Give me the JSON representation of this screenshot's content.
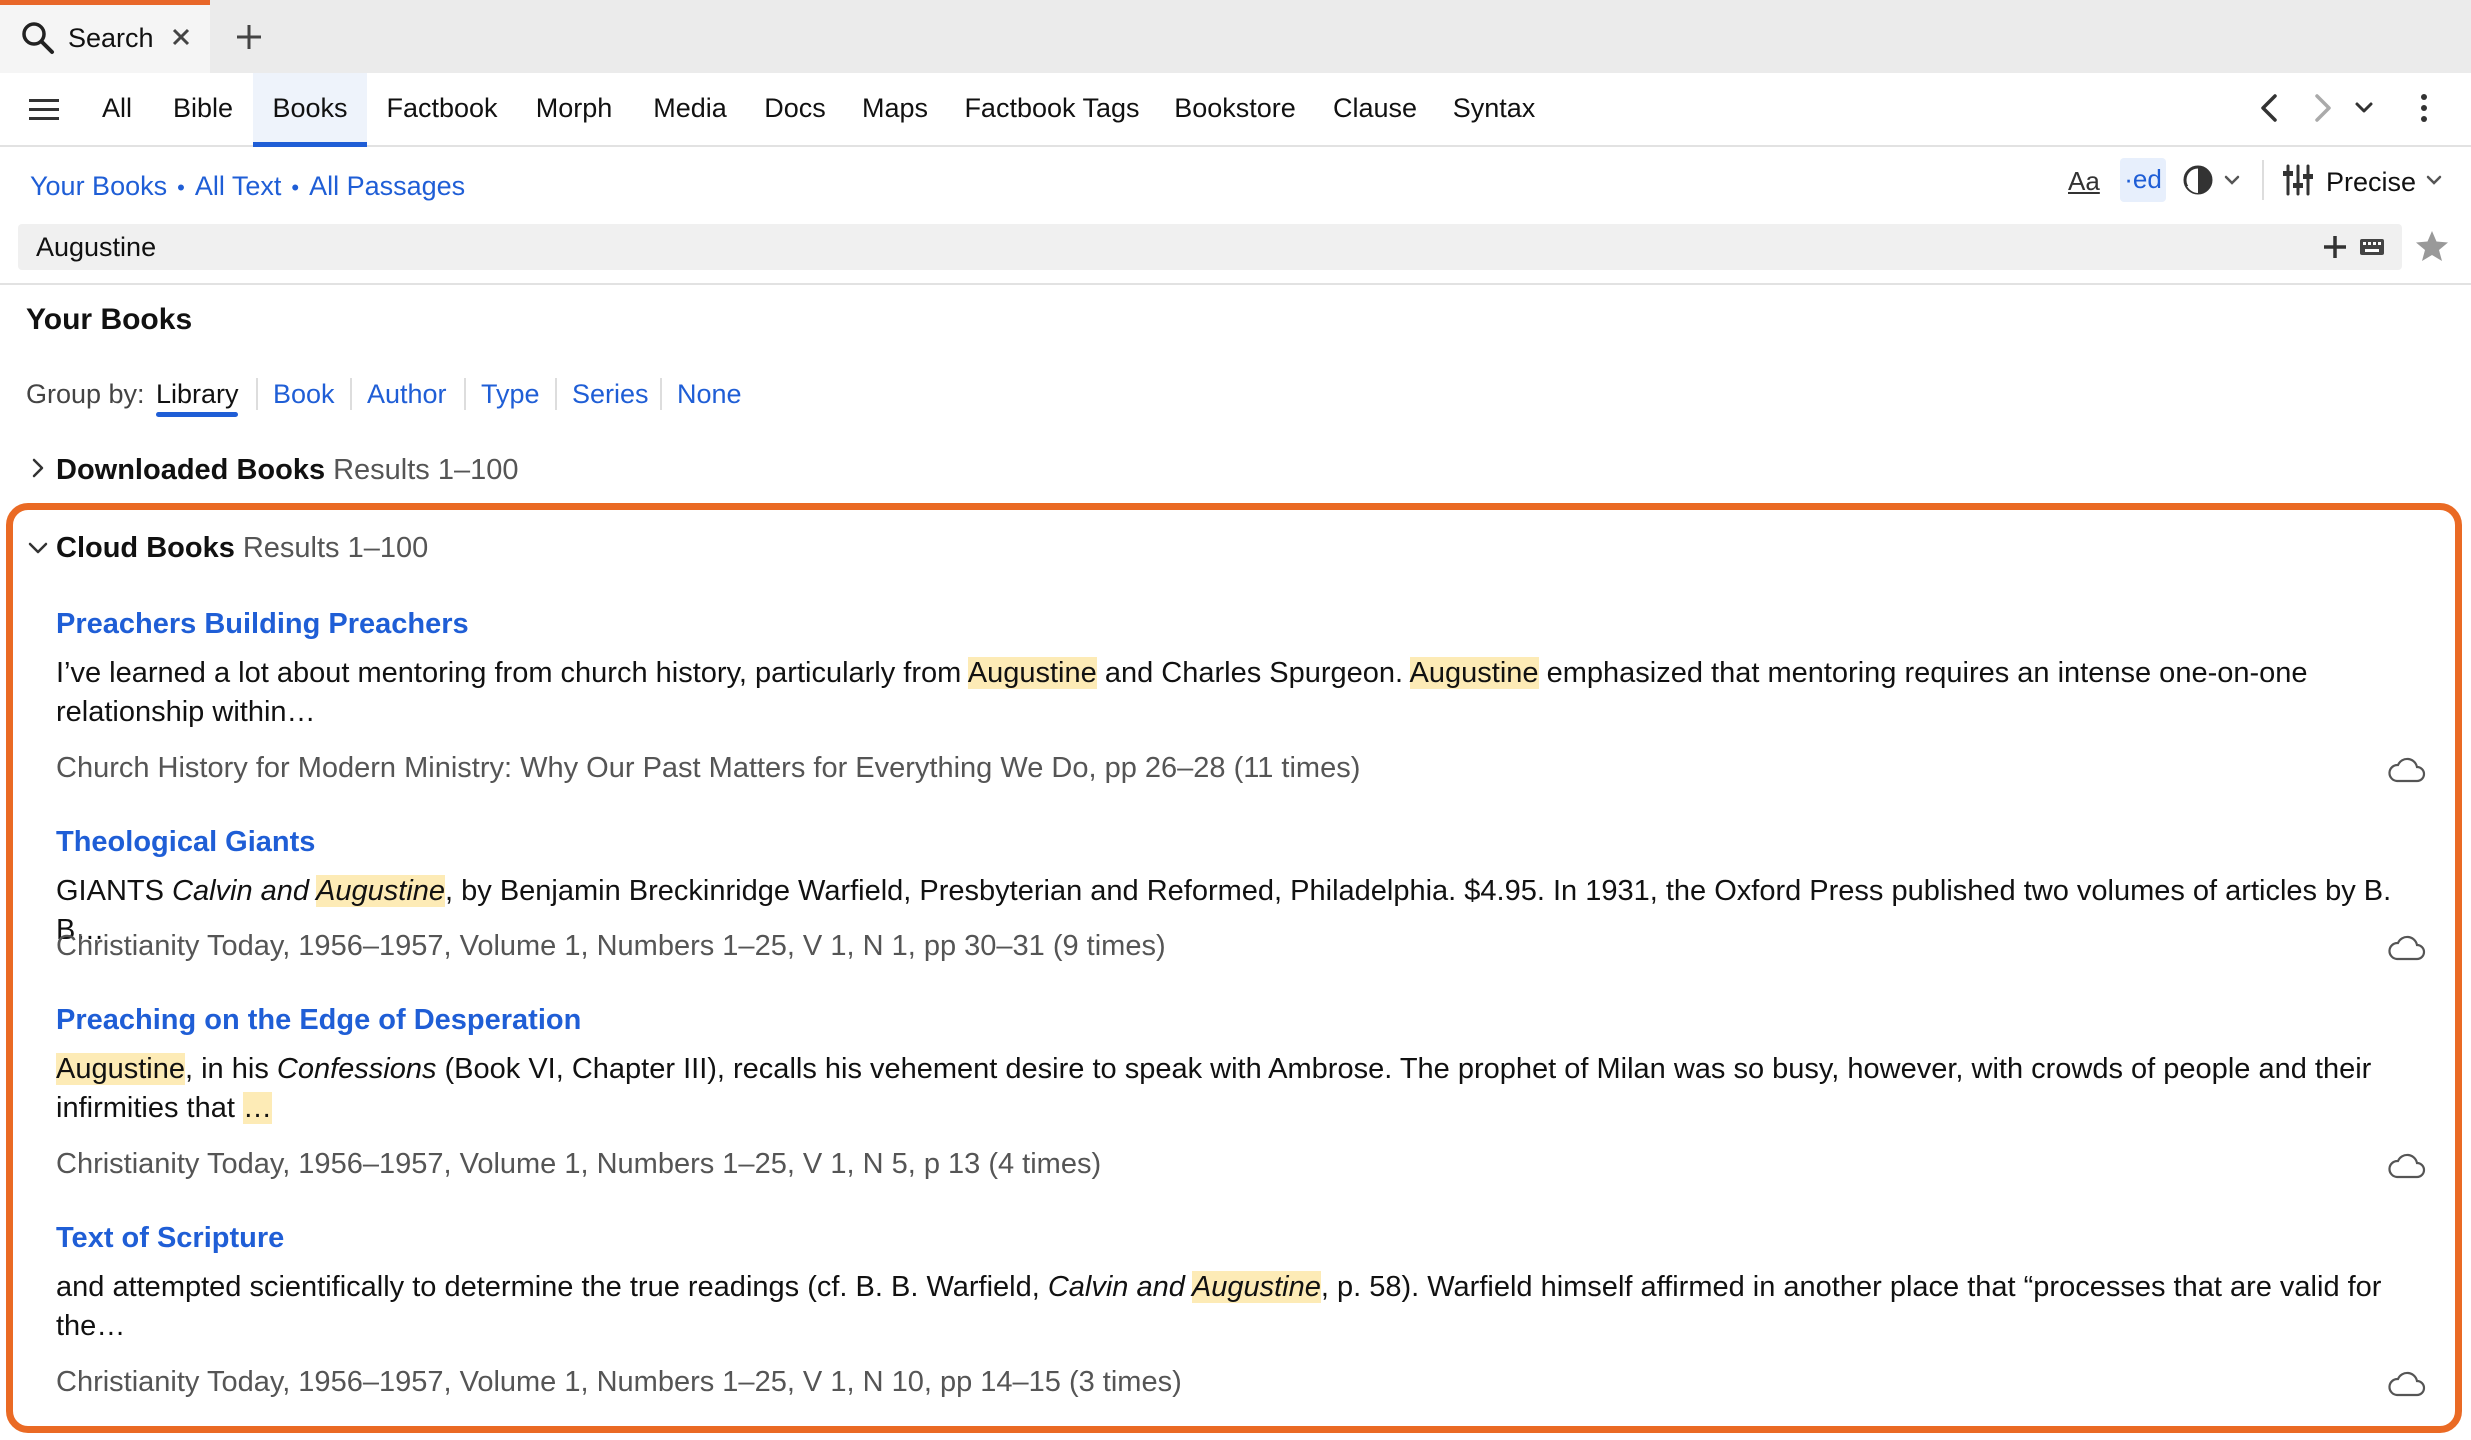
{
  "tab": {
    "title": "Search"
  },
  "nav": {
    "tabs": [
      {
        "label": "All"
      },
      {
        "label": "Bible"
      },
      {
        "label": "Books"
      },
      {
        "label": "Factbook"
      },
      {
        "label": "Morph"
      },
      {
        "label": "Media"
      },
      {
        "label": "Docs"
      },
      {
        "label": "Maps"
      },
      {
        "label": "Factbook Tags"
      },
      {
        "label": "Bookstore"
      },
      {
        "label": "Clause"
      },
      {
        "label": "Syntax"
      }
    ],
    "active": "Books"
  },
  "scope": {
    "books": "Your Books",
    "text": "All Text",
    "passages": "All Passages",
    "separator": "•"
  },
  "options": {
    "case_label": "Aa",
    "match_label": "·ed",
    "mode": "Precise"
  },
  "search": {
    "query": "Augustine"
  },
  "section": {
    "title": "Your Books"
  },
  "group_by": {
    "label": "Group by:",
    "options": [
      "Library",
      "Book",
      "Author",
      "Type",
      "Series",
      "None"
    ],
    "active": "Library"
  },
  "groups": {
    "downloaded": {
      "title": "Downloaded Books",
      "count": "Results 1–100"
    },
    "cloud": {
      "title": "Cloud Books",
      "count": "Results 1–100"
    }
  },
  "results": [
    {
      "title": "Preachers Building Preachers",
      "snippet": [
        {
          "t": "I’ve learned a lot about mentoring from church history, particularly from "
        },
        {
          "t": "Augustine",
          "hl": true
        },
        {
          "t": " and Charles Spurgeon. "
        },
        {
          "t": "Augustine",
          "hl": true
        },
        {
          "t": " emphasized that mentoring requires an intense one-on-one relationship within…"
        }
      ],
      "reference": "Church History for Modern Ministry: Why Our Past Matters for Everything We Do, pp 26–28 (11 times)"
    },
    {
      "title": "Theological Giants",
      "snippet": [
        {
          "t": "GIANTS "
        },
        {
          "t": "Calvin and ",
          "i": true
        },
        {
          "t": "Augustine",
          "hl": true,
          "i": true
        },
        {
          "t": ", by Benjamin Breckinridge Warfield, Presbyterian and Reformed, Philadelphia. $4.95. In 1931, the Oxford Press published two volumes of articles by B. B…"
        }
      ],
      "reference": "Christianity Today, 1956–1957, Volume 1, Numbers 1–25, V 1, N 1, pp 30–31 (9 times)"
    },
    {
      "title": "Preaching on the Edge of Desperation",
      "snippet": [
        {
          "t": "Augustine",
          "hl": true
        },
        {
          "t": ", in his "
        },
        {
          "t": "Confessions",
          "i": true
        },
        {
          "t": " (Book VI, Chapter III), recalls his vehement desire to speak with Ambrose. The prophet of Milan was so busy, however, with crowds of people and their infirmities that "
        },
        {
          "t": "…",
          "hl": true
        }
      ],
      "reference": "Christianity Today, 1956–1957, Volume 1, Numbers 1–25, V 1, N 5, p 13 (4 times)"
    },
    {
      "title": "Text of Scripture",
      "snippet": [
        {
          "t": "and attempted scientifically to determine the true readings (cf. B. B. Warfield, "
        },
        {
          "t": "Calvin and ",
          "i": true
        },
        {
          "t": "Augustine",
          "hl": true,
          "i": true
        },
        {
          "t": ", p. 58). Warfield himself affirmed in another place that “processes that are valid for the…"
        }
      ],
      "reference": "Christianity Today, 1956–1957, Volume 1, Numbers 1–25, V 1, N 10, pp 14–15 (3 times)"
    }
  ],
  "colors": {
    "accent": "#1f5ed6",
    "frame": "#ea6a24",
    "highlight": "#fdebb6",
    "tab_indicator": "#e8672a"
  },
  "icons": [
    "search-icon",
    "close-icon",
    "plus-icon",
    "hamburger-icon",
    "chevron-left-icon",
    "chevron-right-icon",
    "chevron-down-icon",
    "more-vertical-icon",
    "contrast-icon",
    "sliders-icon",
    "keyboard-icon",
    "star-icon",
    "chevron-right-icon",
    "cloud-icon"
  ]
}
